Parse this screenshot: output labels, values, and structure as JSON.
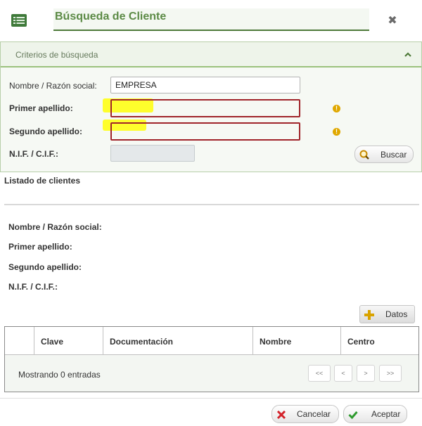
{
  "dialog": {
    "title": "Búsqueda de Cliente",
    "close_label": "✖"
  },
  "criteria": {
    "title": "Criterios de búsqueda",
    "collapse_label": "⌃",
    "fields": {
      "nombre_label": "Nombre / Razón social:",
      "nombre_value": "EMPRESA",
      "primer_label": "Primer apellido:",
      "primer_value": "",
      "segundo_label": "Segundo apellido:",
      "segundo_value": "",
      "nif_label": "N.I.F. / C.I.F.:",
      "nif_value": ""
    },
    "warning_mark": "!",
    "search_button": "Buscar"
  },
  "list": {
    "title": "Listado de clientes",
    "detail": {
      "nombre_label": "Nombre / Razón social:",
      "primer_label": "Primer apellido:",
      "segundo_label": "Segundo apellido:",
      "nif_label": "N.I.F. / C.I.F.:"
    },
    "datos_button": "Datos",
    "columns": [
      "",
      "Clave",
      "Documentación",
      "Nombre",
      "Centro"
    ],
    "footer_text": "Mostrando 0 entradas",
    "pagination": [
      "<<",
      "<",
      ">",
      ">>"
    ]
  },
  "footer": {
    "cancel_label": "Cancelar",
    "accept_label": "Aceptar"
  },
  "colors": {
    "accent": "#5b8a45",
    "error_border": "#a0242a",
    "warning": "#e0a800",
    "highlight": "#ffff00"
  }
}
